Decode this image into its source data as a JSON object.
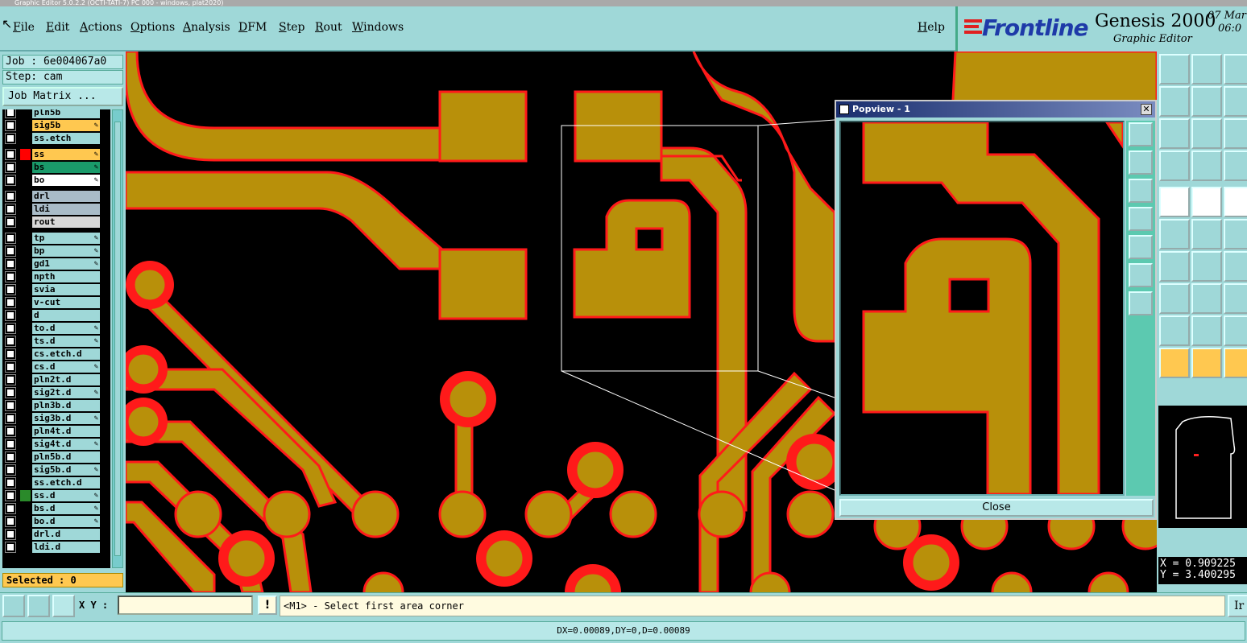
{
  "window": {
    "title": "Graphic Editor 5.0.2.2 (OCTI-TATI-7) PC 000 - windows, plat2020)"
  },
  "menu": {
    "items": [
      "File",
      "Edit",
      "Actions",
      "Options",
      "Analysis",
      "DFM",
      "Step",
      "Rout",
      "Windows"
    ],
    "help": "Help"
  },
  "brand": {
    "logo": "Frontline",
    "product": "Genesis 2000",
    "subtitle": "Graphic Editor",
    "date": "07 Mar",
    "time": "06:0"
  },
  "job": {
    "job_label": "Job : 6e004067a0",
    "step_label": "Step: cam",
    "matrix_button": "Job Matrix ..."
  },
  "layers": [
    {
      "name": "pln5b",
      "color": "#9fd8d8",
      "swatch": "",
      "mark": ""
    },
    {
      "name": "sig5b",
      "color": "#ffc850",
      "swatch": "",
      "mark": "✎"
    },
    {
      "name": "ss.etch",
      "color": "#9fd8d8",
      "swatch": "",
      "mark": ""
    },
    {
      "name": "ss",
      "color": "#ffc850",
      "swatch": "#ff0000",
      "mark": "✎"
    },
    {
      "name": "bs",
      "color": "#1a9a6a",
      "swatch": "",
      "mark": "✎"
    },
    {
      "name": "bo",
      "color": "#ffffff",
      "swatch": "",
      "mark": "✎"
    },
    {
      "name": "drl",
      "color": "#a9bcc8",
      "swatch": "",
      "mark": ""
    },
    {
      "name": "ldi",
      "color": "#a9bcc8",
      "swatch": "",
      "mark": ""
    },
    {
      "name": "rout",
      "color": "#d8d8d8",
      "swatch": "",
      "mark": ""
    },
    {
      "name": "tp",
      "color": "#9fd8d8",
      "swatch": "",
      "mark": "✎"
    },
    {
      "name": "bp",
      "color": "#9fd8d8",
      "swatch": "",
      "mark": "✎"
    },
    {
      "name": "gd1",
      "color": "#9fd8d8",
      "swatch": "",
      "mark": "✎"
    },
    {
      "name": "npth",
      "color": "#9fd8d8",
      "swatch": "",
      "mark": ""
    },
    {
      "name": "svia",
      "color": "#9fd8d8",
      "swatch": "",
      "mark": ""
    },
    {
      "name": "v-cut",
      "color": "#9fd8d8",
      "swatch": "",
      "mark": ""
    },
    {
      "name": "d",
      "color": "#9fd8d8",
      "swatch": "",
      "mark": ""
    },
    {
      "name": "to.d",
      "color": "#9fd8d8",
      "swatch": "",
      "mark": "✎"
    },
    {
      "name": "ts.d",
      "color": "#9fd8d8",
      "swatch": "",
      "mark": "✎"
    },
    {
      "name": "cs.etch.d",
      "color": "#9fd8d8",
      "swatch": "",
      "mark": ""
    },
    {
      "name": "cs.d",
      "color": "#9fd8d8",
      "swatch": "",
      "mark": "✎"
    },
    {
      "name": "pln2t.d",
      "color": "#9fd8d8",
      "swatch": "",
      "mark": ""
    },
    {
      "name": "sig2t.d",
      "color": "#9fd8d8",
      "swatch": "",
      "mark": "✎"
    },
    {
      "name": "pln3b.d",
      "color": "#9fd8d8",
      "swatch": "",
      "mark": ""
    },
    {
      "name": "sig3b.d",
      "color": "#9fd8d8",
      "swatch": "",
      "mark": "✎"
    },
    {
      "name": "pln4t.d",
      "color": "#9fd8d8",
      "swatch": "",
      "mark": ""
    },
    {
      "name": "sig4t.d",
      "color": "#9fd8d8",
      "swatch": "",
      "mark": "✎"
    },
    {
      "name": "pln5b.d",
      "color": "#9fd8d8",
      "swatch": "",
      "mark": ""
    },
    {
      "name": "sig5b.d",
      "color": "#9fd8d8",
      "swatch": "",
      "mark": "✎"
    },
    {
      "name": "ss.etch.d",
      "color": "#9fd8d8",
      "swatch": "",
      "mark": ""
    },
    {
      "name": "ss.d",
      "color": "#9fd8d8",
      "swatch": "#2a8a2a",
      "mark": "✎"
    },
    {
      "name": "bs.d",
      "color": "#9fd8d8",
      "swatch": "",
      "mark": "✎"
    },
    {
      "name": "bo.d",
      "color": "#9fd8d8",
      "swatch": "",
      "mark": "✎"
    },
    {
      "name": "drl.d",
      "color": "#9fd8d8",
      "swatch": "",
      "mark": ""
    },
    {
      "name": "ldi.d",
      "color": "#9fd8d8",
      "swatch": "",
      "mark": ""
    }
  ],
  "selected": "Selected : 0",
  "popview": {
    "title": "Popview - 1",
    "close_label": "Close"
  },
  "coords": {
    "x": "X = 0.909225",
    "y": "Y = 3.400295"
  },
  "bottom": {
    "xy_label": "X Y :",
    "xy_value": "",
    "warn": "!",
    "prompt": "<M1> - Select first area corner",
    "mode": "Ir"
  },
  "status": "DX=0.00089,DY=0,D=0.00089",
  "colors": {
    "copper": "#b8900a",
    "outline": "#ff1a1a",
    "background": "#000000",
    "panel": "#9fd8d8",
    "highlight": "#ffc850"
  }
}
